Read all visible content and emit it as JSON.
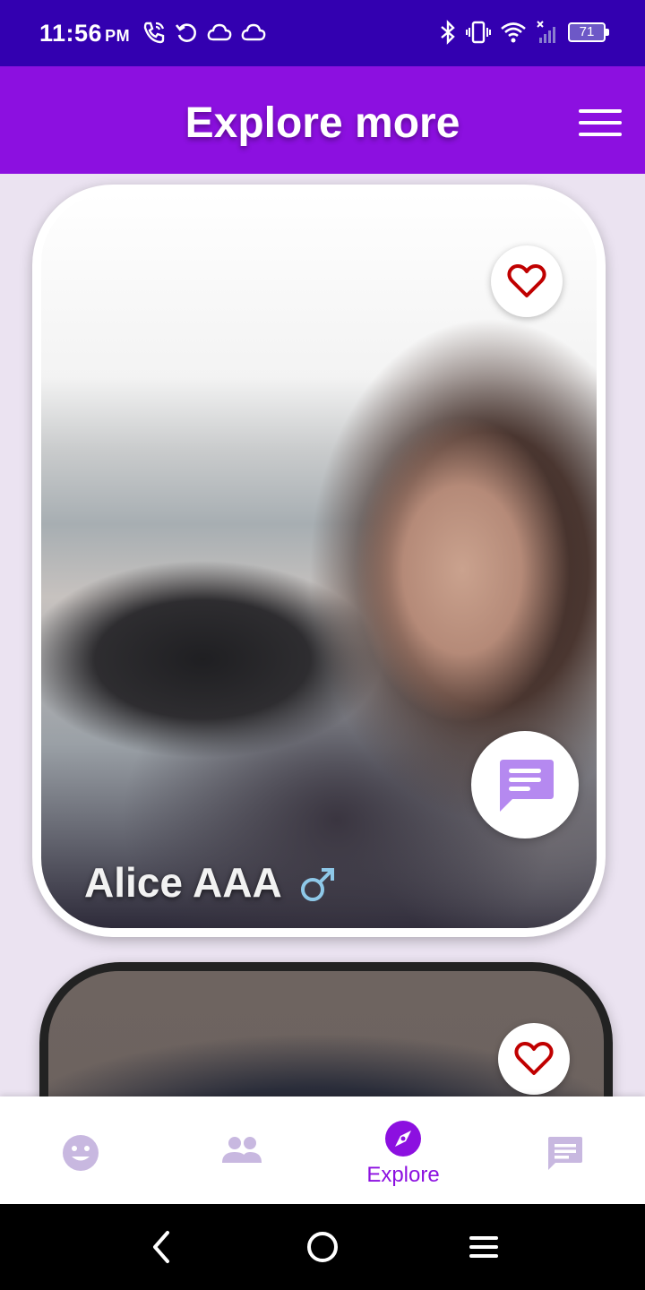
{
  "status_bar": {
    "time": "11:56",
    "ampm": "PM",
    "battery": "71",
    "left_icons": [
      "wifi-call-icon",
      "sync-icon",
      "cloud-icon",
      "cloud-icon"
    ],
    "right_icons": [
      "bluetooth-icon",
      "vibrate-icon",
      "wifi-icon",
      "signal-icon",
      "battery-icon"
    ]
  },
  "app_bar": {
    "title": "Explore more",
    "menu_icon": "hamburger-menu-icon"
  },
  "cards": [
    {
      "name": "Alice AAA",
      "gender_icon": "male-symbol-icon",
      "favorite_icon": "heart-outline-icon",
      "chat_icon": "chat-bubble-icon"
    },
    {
      "favorite_icon": "heart-outline-icon"
    }
  ],
  "bottom_nav": {
    "items": [
      {
        "icon": "smiley-face-icon",
        "label": ""
      },
      {
        "icon": "people-icon",
        "label": ""
      },
      {
        "icon": "compass-icon",
        "label": "Explore"
      },
      {
        "icon": "message-icon",
        "label": ""
      }
    ],
    "active_index": 2
  },
  "system_nav": {
    "buttons": [
      "back-icon",
      "home-icon",
      "menu-icon"
    ]
  },
  "colors": {
    "status_bar": "#3300b0",
    "app_bar": "#8c10e0",
    "background": "#ebe3f1",
    "accent": "#8c10e0",
    "heart": "#c00000",
    "nav_inactive": "#c8b8e0",
    "chat_fab_icon": "#b589f0",
    "gender_icon": "#8ec8e8"
  }
}
